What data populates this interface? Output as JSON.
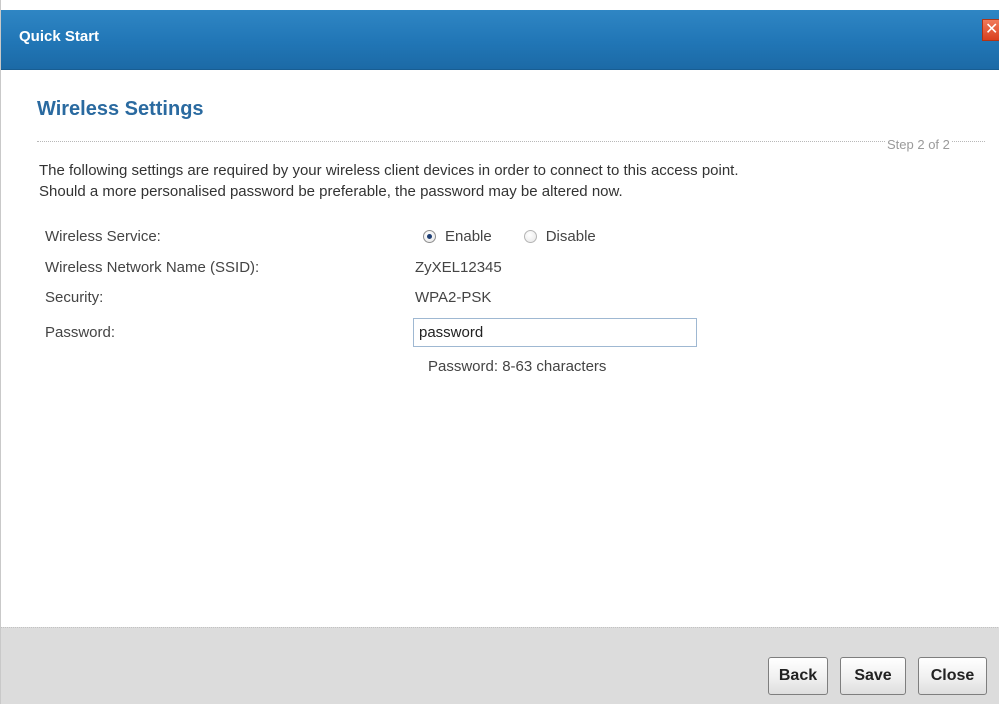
{
  "window": {
    "title": "Quick Start",
    "close_symbol": "✕"
  },
  "page": {
    "heading": "Wireless Settings",
    "step": "Step 2 of 2",
    "intro_line1": "The following settings are required by your wireless client devices in order to connect to this access point.",
    "intro_line2": "Should a more personalised password be preferable, the password may be altered now."
  },
  "form": {
    "wireless_service_label": "Wireless Service:",
    "enable_label": "Enable",
    "disable_label": "Disable",
    "wireless_service_selected": "Enable",
    "ssid_label": "Wireless Network Name (SSID):",
    "ssid_value": "ZyXEL12345",
    "security_label": "Security:",
    "security_value": "WPA2-PSK",
    "password_label": "Password:",
    "password_value": "password",
    "password_hint": "Password: 8-63 characters"
  },
  "buttons": {
    "back": "Back",
    "save": "Save",
    "close": "Close"
  },
  "colors": {
    "titlebar": "#2176b6",
    "heading": "#2a6aa0",
    "footer": "#dcdcdc",
    "close_button": "#d9401e"
  },
  "icons": {
    "close": "close-icon",
    "radio_checked": "radio-checked-icon",
    "radio_unchecked": "radio-unchecked-icon"
  }
}
